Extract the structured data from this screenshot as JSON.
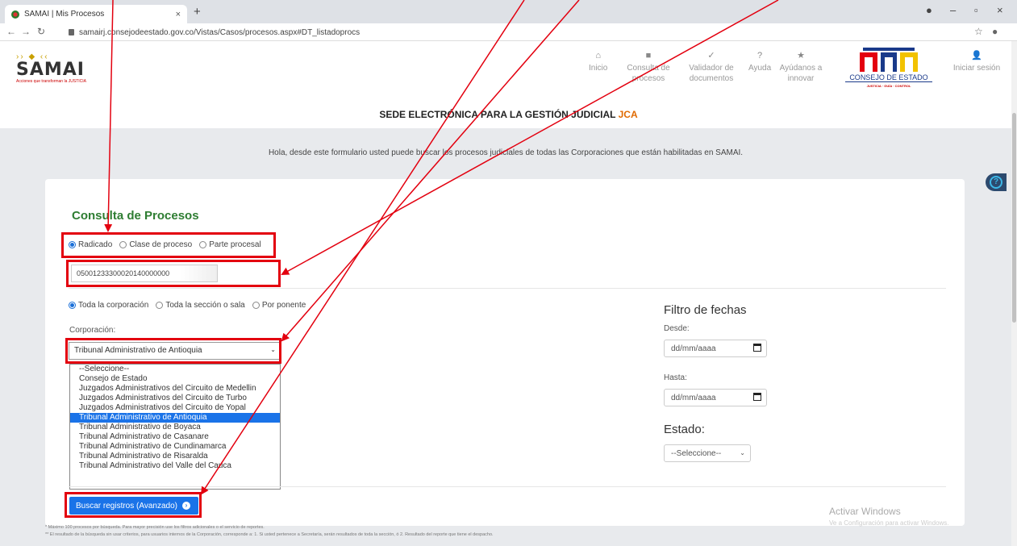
{
  "browser": {
    "tab_title": "SAMAI | Mis Procesos",
    "tab_close": "×",
    "new_tab": "+",
    "url": "samairj.consejodeestado.gov.co/Vistas/Casos/procesos.aspx#DT_listadoprocs"
  },
  "header": {
    "logo_text": "SAMAI",
    "logo_tagline": "Acciones que transforman la JUSTICIA",
    "nav": [
      {
        "label": "Inicio",
        "icon": "home-icon"
      },
      {
        "label": "Consulta de procesos",
        "icon": "folder-icon"
      },
      {
        "label": "Validador de documentos",
        "icon": "validate-icon"
      },
      {
        "label": "Ayuda",
        "icon": "help-icon"
      },
      {
        "label": "Ayúdanos a innovar",
        "icon": "star-icon"
      }
    ],
    "cde_name": "CONSEJO DE ESTADO",
    "cde_sub": "JUSTICIA · GUÍA · CONTROL",
    "login": "Iniciar sesión"
  },
  "page": {
    "title": "SEDE ELECTRÓNICA PARA LA GESTIÓN JUDICIAL",
    "title_accent": "JCA",
    "welcome": "Hola, desde este formulario usted puede buscar los procesos judiciales de todas las Corporaciones que están habilitadas en SAMAI."
  },
  "form": {
    "heading": "Consulta de Procesos",
    "search_type": [
      "Radicado",
      "Clase de proceso",
      "Parte procesal"
    ],
    "search_type_selected": 0,
    "radicado_value": "05001233300020140000000",
    "scope": [
      "Toda la corporación",
      "Toda la sección o sala",
      "Por ponente"
    ],
    "scope_selected": 0,
    "corporacion_label": "Corporación:",
    "corporacion_value": "Tribunal Administrativo de Antioquia",
    "corporacion_options": [
      "--Seleccione--",
      "Consejo de Estado",
      "Juzgados Administrativos del Circuito de Medellin",
      "Juzgados Administrativos del Circuito de Turbo",
      "Juzgados Administrativos del Circuito de Yopal",
      "Tribunal Administrativo de Antioquia",
      "Tribunal Administrativo de Boyaca",
      "Tribunal Administrativo de Casanare",
      "Tribunal Administrativo de Cundinamarca",
      "Tribunal Administrativo de Risaralda",
      "Tribunal Administrativo del Valle del Cauca"
    ],
    "corporacion_option_selected": 5,
    "date_filter_title": "Filtro de fechas",
    "desde_label": "Desde:",
    "hasta_label": "Hasta:",
    "date_placeholder": "dd/mm/aaaa",
    "estado_label": "Estado:",
    "estado_value": "--Seleccione--",
    "search_button": "Buscar registros (Avanzado)"
  },
  "footer": {
    "note1": "* Máximo 100 procesos por búsqueda. Para mayor precisión use los filtros adicionales o el servicio de reportes.",
    "note2": "** El resultado de la búsqueda sin usar criterios, para usuarios internos de la Corporación, corresponde a: 1. Si usted pertenece a Secretaría, serán resultados de toda la sección, ó 2. Resultado del reporte que tiene el despacho."
  },
  "watermark": {
    "line1": "Activar Windows",
    "line2": "Ve a Configuración para activar Windows."
  },
  "colors": {
    "accent": "#1a73e8",
    "heading_green": "#2e7d32",
    "annotation_red": "#e3000f",
    "jca_orange": "#e06a00"
  }
}
